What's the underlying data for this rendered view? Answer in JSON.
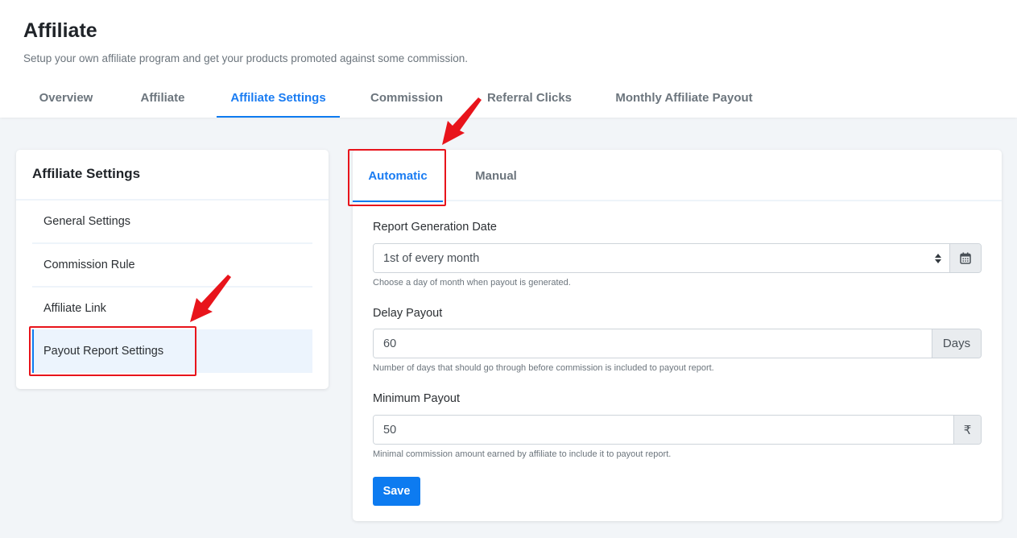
{
  "header": {
    "title": "Affiliate",
    "subtitle": "Setup your own affiliate program and get your products promoted against some commission.",
    "tabs": [
      {
        "label": "Overview",
        "active": false
      },
      {
        "label": "Affiliate",
        "active": false
      },
      {
        "label": "Affiliate Settings",
        "active": true
      },
      {
        "label": "Commission",
        "active": false
      },
      {
        "label": "Referral Clicks",
        "active": false
      },
      {
        "label": "Monthly Affiliate Payout",
        "active": false
      }
    ]
  },
  "sidebar": {
    "title": "Affiliate Settings",
    "items": [
      {
        "label": "General Settings",
        "active": false
      },
      {
        "label": "Commission Rule",
        "active": false
      },
      {
        "label": "Affiliate Link",
        "active": false
      },
      {
        "label": "Payout Report Settings",
        "active": true
      }
    ]
  },
  "payout": {
    "tabs": [
      {
        "label": "Automatic",
        "active": true
      },
      {
        "label": "Manual",
        "active": false
      }
    ],
    "fields": {
      "report_date": {
        "label": "Report Generation Date",
        "value": "1st of every month",
        "addon_icon": "calendar-icon",
        "help": "Choose a day of month when payout is generated."
      },
      "delay": {
        "label": "Delay Payout",
        "value": "60",
        "addon": "Days",
        "help": "Number of days that should go through before commission is included to payout report."
      },
      "minimum": {
        "label": "Minimum Payout",
        "value": "50",
        "addon": "₹",
        "help": "Minimal commission amount earned by affiliate to include it to payout report."
      }
    },
    "save_label": "Save"
  },
  "annotations": {
    "color": "#e8141b",
    "highlights": [
      "Payout Report Settings",
      "Automatic"
    ]
  },
  "colors": {
    "accent": "#0d7bf0",
    "background": "#f2f5f8",
    "muted_text": "#6c757d"
  }
}
